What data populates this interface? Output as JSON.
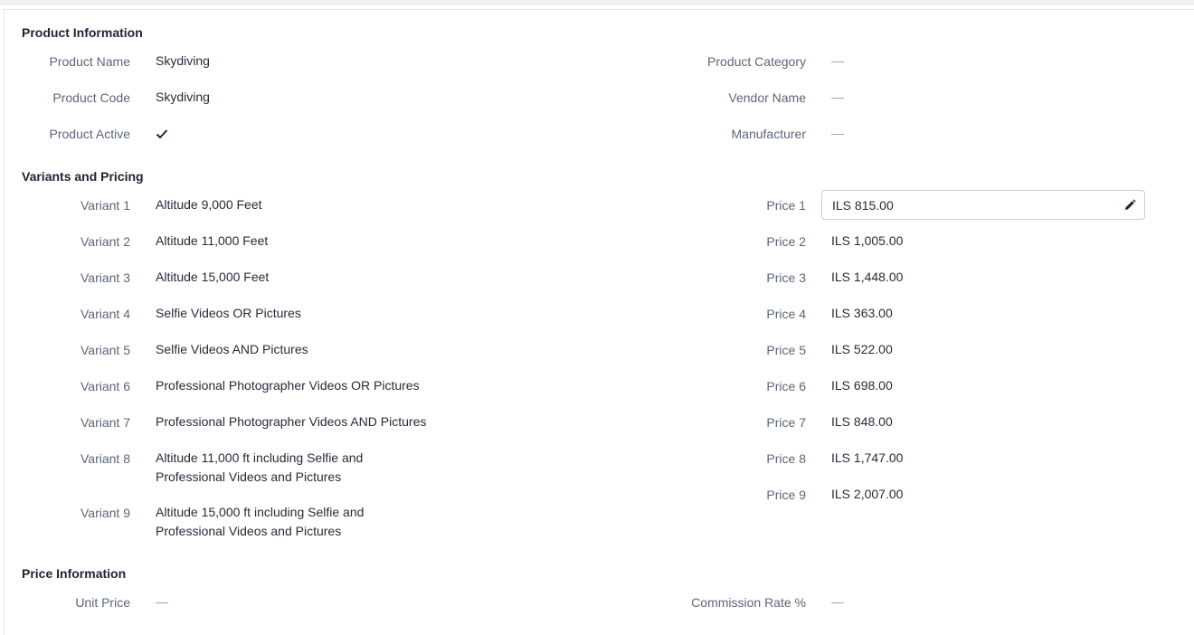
{
  "sections": {
    "product_information": "Product Information",
    "variants_and_pricing": "Variants and Pricing",
    "price_information": "Price Information"
  },
  "product": {
    "name_label": "Product Name",
    "name_value": "Skydiving",
    "code_label": "Product Code",
    "code_value": "Skydiving",
    "active_label": "Product Active",
    "category_label": "Product Category",
    "category_value": "—",
    "vendor_label": "Vendor Name",
    "vendor_value": "—",
    "manufacturer_label": "Manufacturer",
    "manufacturer_value": "—"
  },
  "variants": [
    {
      "label": "Variant 1",
      "value": "Altitude 9,000 Feet"
    },
    {
      "label": "Variant 2",
      "value": "Altitude 11,000 Feet"
    },
    {
      "label": "Variant 3",
      "value": "Altitude 15,000 Feet"
    },
    {
      "label": "Variant 4",
      "value": "Selfie Videos OR Pictures"
    },
    {
      "label": "Variant 5",
      "value": "Selfie Videos AND Pictures"
    },
    {
      "label": "Variant 6",
      "value": "Professional Photographer Videos OR Pictures"
    },
    {
      "label": "Variant 7",
      "value": "Professional Photographer Videos AND Pictures"
    },
    {
      "label": "Variant 8",
      "value": "Altitude 11,000 ft including Selfie and Professional Videos and Pictures"
    },
    {
      "label": "Variant 9",
      "value": "Altitude 15,000 ft including Selfie and Professional Videos and Pictures"
    }
  ],
  "prices": [
    {
      "label": "Price 1",
      "value": "ILS 815.00"
    },
    {
      "label": "Price 2",
      "value": "ILS 1,005.00"
    },
    {
      "label": "Price 3",
      "value": "ILS 1,448.00"
    },
    {
      "label": "Price 4",
      "value": "ILS 363.00"
    },
    {
      "label": "Price 5",
      "value": "ILS 522.00"
    },
    {
      "label": "Price 6",
      "value": "ILS 698.00"
    },
    {
      "label": "Price 7",
      "value": "ILS 848.00"
    },
    {
      "label": "Price 8",
      "value": "ILS 1,747.00"
    },
    {
      "label": "Price 9",
      "value": "ILS 2,007.00"
    }
  ],
  "price_info": {
    "unit_price_label": "Unit Price",
    "unit_price_value": "—",
    "commission_rate_label": "Commission Rate %",
    "commission_rate_value": "—"
  },
  "icons": {
    "check": "check-icon",
    "edit": "pencil-icon"
  }
}
